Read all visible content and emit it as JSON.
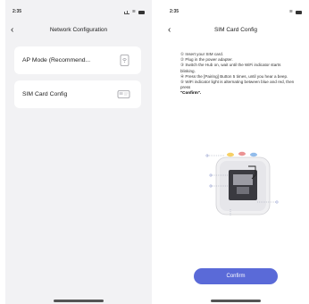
{
  "left_screen": {
    "status": {
      "time": "2:35"
    },
    "nav": {
      "title": "Network Configuration"
    },
    "items": [
      {
        "label": "AP Mode (Recommend...",
        "icon": "router-icon"
      },
      {
        "label": "SIM Card Config",
        "icon": "sim-card-icon"
      }
    ]
  },
  "right_screen": {
    "status": {
      "time": "2:35"
    },
    "nav": {
      "title": "SIM Card Config"
    },
    "steps": [
      "① Insert your SIM card.",
      "② Plug in the power adapter.",
      "③ Switch the Hub on, wait until the WiFi indicator starts blinking.",
      "④ Press the [Pairing] Button 5 times, until you hear a beep.",
      "⑤ WiFi indicator light is alternating between blue and red, then press"
    ],
    "confirm_word": "\"Confirm\".",
    "confirm_button": "Confirm",
    "device_illustration": "hub-device-illustration"
  },
  "colors": {
    "accent": "#5a6ad8",
    "page_bg_left": "#f2f2f4",
    "card_bg": "#ffffff"
  }
}
